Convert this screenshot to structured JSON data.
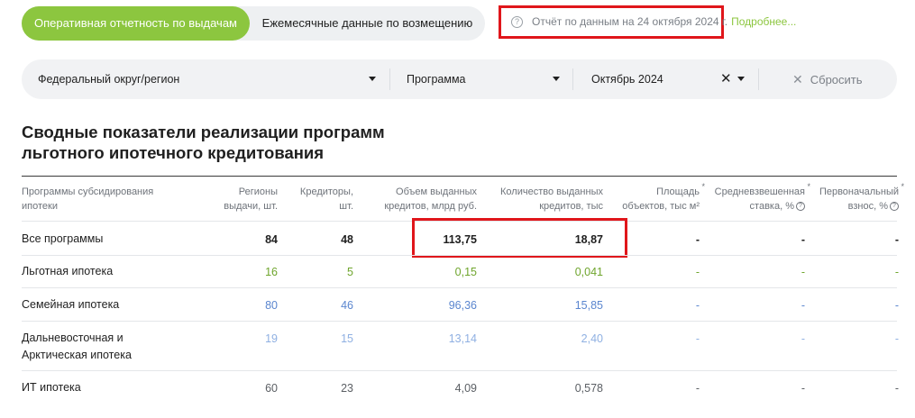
{
  "tabs": [
    {
      "label": "Оперативная отчетность по выдачам",
      "active": true
    },
    {
      "label": "Ежемесячные данные по возмещению",
      "active": false
    }
  ],
  "note": {
    "icon": "question-circle-icon",
    "text": "Отчёт по данным на 24 октября 2024 г.",
    "more_link": "Подробнее..."
  },
  "filters": {
    "region": "Федеральный округ/регион",
    "program": "Программа",
    "month": "Октябрь 2024",
    "reset": "Сбросить"
  },
  "title": "Сводные показатели реализации программ льготного ипотечного кредитования",
  "table": {
    "headers": {
      "program": "Программы субсидирования ипотеки",
      "regions": "Регионы выдачи, шт.",
      "creditors": "Кредиторы, шт.",
      "volume": "Объем выданных кредитов, млрд руб.",
      "count": "Количество выданных кредитов, тыс",
      "area": "Площадь объектов, тыс м²",
      "rate": "Средневзвешенная ставка, %",
      "downpayment": "Первоначальный взнос, %"
    },
    "rows": [
      {
        "name": "Все программы",
        "regions": "84",
        "creditors": "48",
        "volume": "113,75",
        "count": "18,87",
        "area": "-",
        "rate": "-",
        "downpayment": "-",
        "color": "#1f1f1f"
      },
      {
        "name": "Льготная ипотека",
        "regions": "16",
        "creditors": "5",
        "volume": "0,15",
        "count": "0,041",
        "area": "-",
        "rate": "-",
        "downpayment": "-",
        "color": "#6fa52d"
      },
      {
        "name": "Семейная ипотека",
        "regions": "80",
        "creditors": "46",
        "volume": "96,36",
        "count": "15,85",
        "area": "-",
        "rate": "-",
        "downpayment": "-",
        "color": "#5b86cf"
      },
      {
        "name": "Дальневосточная и Арктическая ипотека",
        "regions": "19",
        "creditors": "15",
        "volume": "13,14",
        "count": "2,40",
        "area": "-",
        "rate": "-",
        "downpayment": "-",
        "color": "#8fb0e2"
      },
      {
        "name": "ИТ ипотека",
        "regions": "60",
        "creditors": "23",
        "volume": "4,09",
        "count": "0,578",
        "area": "-",
        "rate": "-",
        "downpayment": "-",
        "color": "#5b5f64"
      }
    ]
  },
  "colors": {
    "accent": "#8cc63f",
    "highlight_border": "#e0161b"
  }
}
